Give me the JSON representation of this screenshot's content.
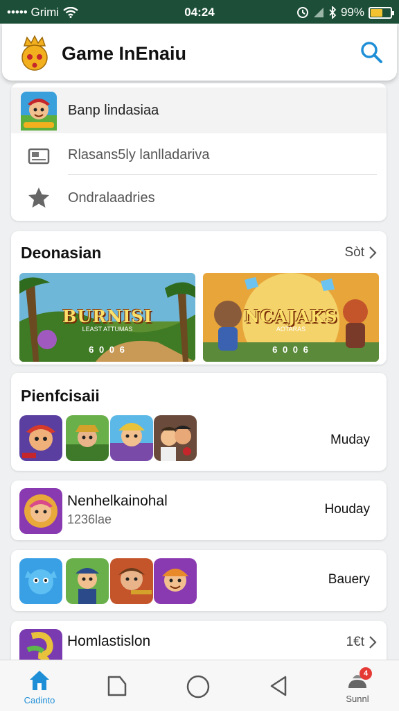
{
  "status": {
    "carrier": "••••• Grimi",
    "time": "04:24",
    "battery": "99%",
    "battery_level": 0.6
  },
  "header": {
    "title": "Game InEnaiu"
  },
  "menu": {
    "items": [
      {
        "label": "Banp lindasiaa",
        "icon": "game-app-icon"
      },
      {
        "label": "Rlasans5ly lanlladariva",
        "icon": "image-card-icon"
      },
      {
        "label": "Ondralaadries",
        "icon": "star-icon"
      }
    ]
  },
  "featured": {
    "title": "Deonasian",
    "see_all": "Sòt",
    "banners": [
      {
        "title": "BURNISI",
        "subtitle": "LEAST ATTUMAS",
        "meta": "6 0 0 6"
      },
      {
        "title": "NCAJAKS",
        "subtitle": "AOTARAS",
        "meta": "6 0 0 6"
      }
    ]
  },
  "section_popular": {
    "title": "Pienfcisaii",
    "right_label": "Muday"
  },
  "section_single": {
    "name": "Nenhelkainohal",
    "meta": "1236lae",
    "right_label": "Houday"
  },
  "section_three": {
    "right_label": "Bauery"
  },
  "section_last": {
    "name": "Homlastislon",
    "right_label": "1€t"
  },
  "nav": [
    {
      "label": "Cadinto",
      "icon": "home-icon",
      "active": true
    },
    {
      "label": "",
      "icon": "recents-icon",
      "active": false
    },
    {
      "label": "",
      "icon": "circle-home-icon",
      "active": false
    },
    {
      "label": "",
      "icon": "back-triangle-icon",
      "active": false
    },
    {
      "label": "Sunnl",
      "icon": "profile-icon",
      "active": false,
      "badge": "4"
    }
  ],
  "colors": {
    "status_bar": "#1d4f38",
    "accent": "#1e8fd6",
    "badge": "#e53935",
    "battery": "#f2c230"
  }
}
